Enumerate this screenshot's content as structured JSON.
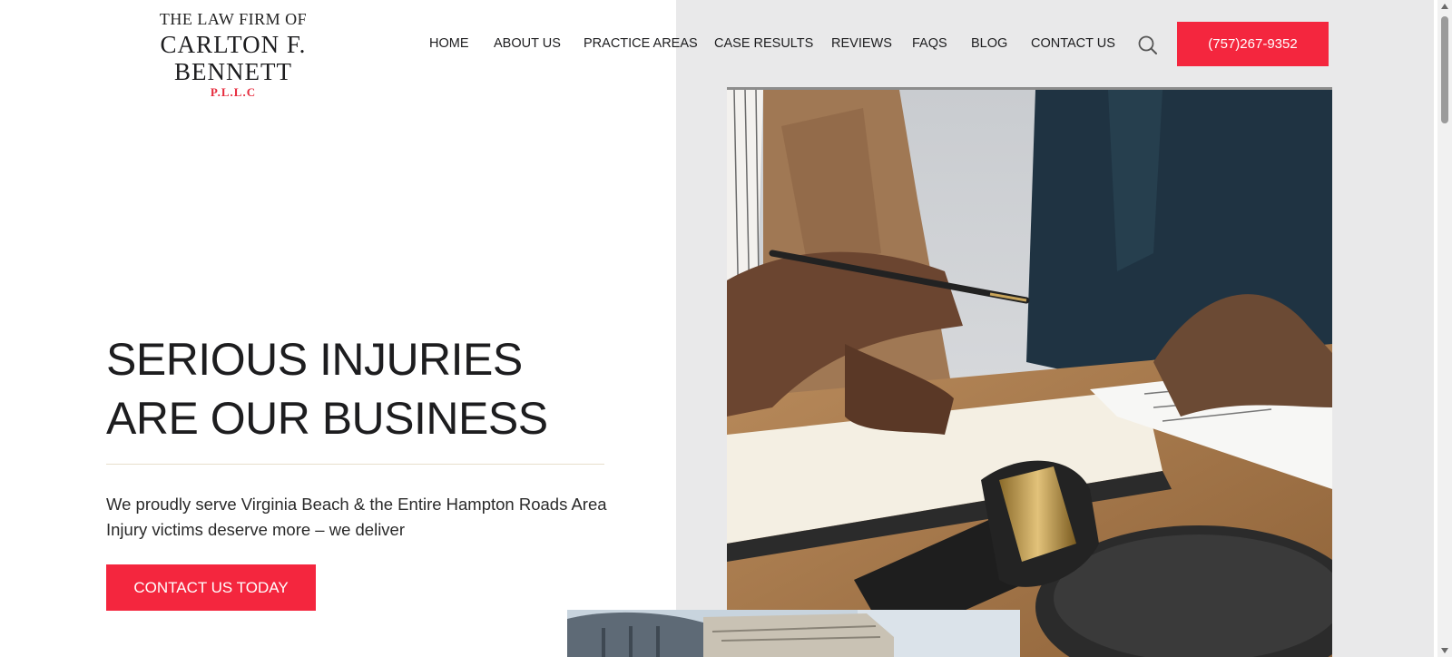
{
  "logo": {
    "line1": "THE LAW FIRM OF",
    "line2": "CARLTON F. BENNETT",
    "line3": "P.L.L.C"
  },
  "nav": {
    "items": [
      "HOME",
      "ABOUT US",
      "PRACTICE AREAS",
      "CASE RESULTS",
      "REVIEWS",
      "FAQS",
      "BLOG",
      "CONTACT US"
    ],
    "search_icon": "search-icon",
    "phone": "(757)267-9352"
  },
  "hero": {
    "headline": "SERIOUS INJURIES ARE OUR BUSINESS",
    "subtext": "We proudly serve Virginia Beach & the Entire Hampton Roads Area Injury victims deserve more – we deliver",
    "cta": "CONTACT US TODAY"
  },
  "colors": {
    "accent": "#f4263e",
    "logo_accent": "#e62b3d",
    "panel_bg": "#e9e9ea",
    "text": "#1d1d1f"
  }
}
